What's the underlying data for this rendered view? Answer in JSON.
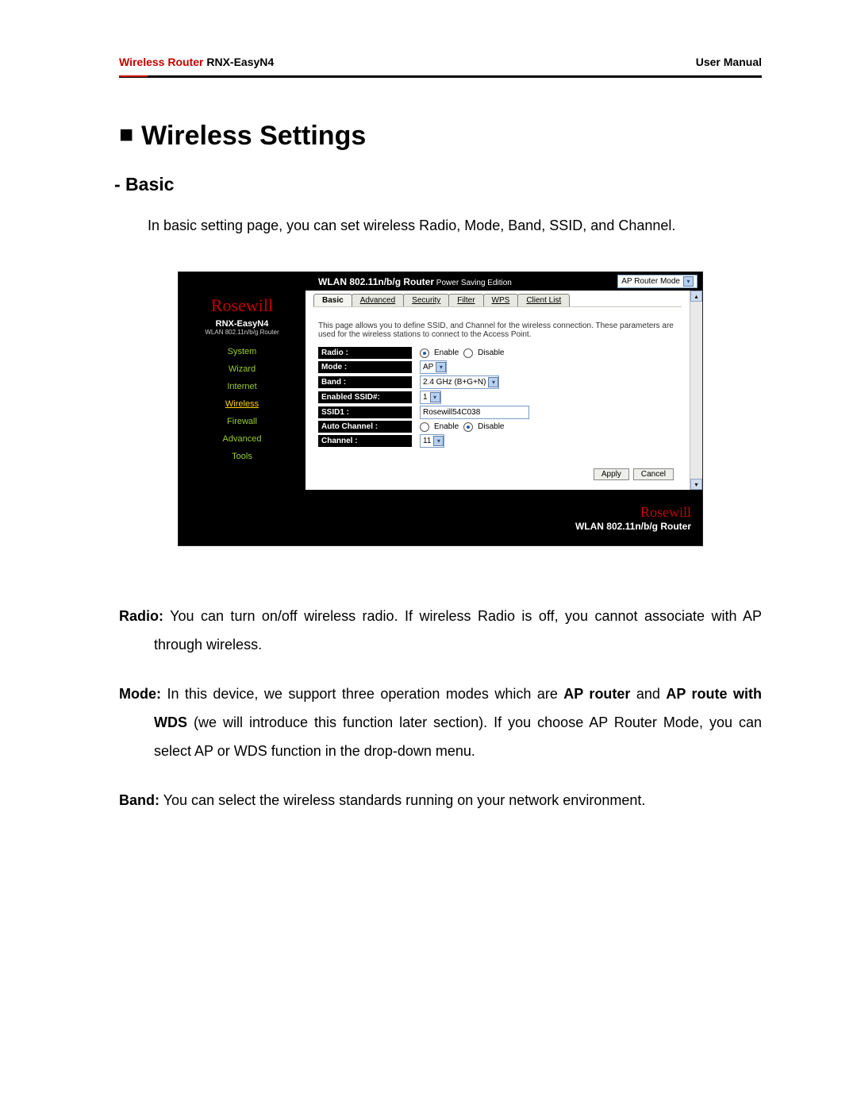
{
  "header": {
    "prefix": "Wireless Router",
    "model": " RNX-EasyN4",
    "right": "User Manual"
  },
  "section": {
    "title": "Wireless Settings",
    "subtitle": "- Basic",
    "intro": "In basic setting page, you can set wireless Radio, Mode, Band, SSID, and Channel."
  },
  "shot": {
    "titlebar": {
      "title": "WLAN 802.11n/b/g Router",
      "subtitle": " Power Saving Edition",
      "mode_selector": "AP Router Mode"
    },
    "sidebar": {
      "logo": "Rosewill",
      "model": "RNX-EasyN4",
      "sub": "WLAN 802.11n/b/g Router",
      "items": [
        "System",
        "Wizard",
        "Internet",
        "Wireless",
        "Firewall",
        "Advanced",
        "Tools"
      ],
      "active_index": 3
    },
    "tabs": [
      "Basic",
      "Advanced",
      "Security",
      "Filter",
      "WPS",
      "Client List"
    ],
    "tab_selected_index": 0,
    "description": "This page allows you to define SSID, and Channel for the wireless connection. These parameters are used for the wireless stations to connect to the Access Point.",
    "form": {
      "radio": {
        "label": "Radio :",
        "options": [
          "Enable",
          "Disable"
        ],
        "selected": "Enable"
      },
      "mode": {
        "label": "Mode :",
        "value": "AP"
      },
      "band": {
        "label": "Band :",
        "value": "2.4 GHz (B+G+N)"
      },
      "enabled_ssid": {
        "label": "Enabled SSID#:",
        "value": "1"
      },
      "ssid1": {
        "label": "SSID1 :",
        "value": "Rosewill54C038"
      },
      "auto_channel": {
        "label": "Auto Channel :",
        "options": [
          "Enable",
          "Disable"
        ],
        "selected": "Disable"
      },
      "channel": {
        "label": "Channel :",
        "value": "11"
      }
    },
    "buttons": {
      "apply": "Apply",
      "cancel": "Cancel"
    },
    "footer": {
      "logo": "Rosewill",
      "text": "WLAN 802.11n/b/g Router"
    }
  },
  "defs": {
    "radio_label": "Radio:",
    "radio_text": " You can turn on/off wireless radio. If wireless Radio is off, you cannot associate with AP through wireless.",
    "mode_label": "Mode:",
    "mode_text_a": " In this device, we support three operation modes which are ",
    "mode_bold_a": "AP router",
    "mode_text_b": " and ",
    "mode_bold_b": "AP route with WDS",
    "mode_text_c": " (we will introduce this function later section). If you choose AP Router Mode, you can select AP or WDS function in the drop-down menu.",
    "band_label": "Band:",
    "band_text": " You can select the wireless standards running on your network environment."
  }
}
